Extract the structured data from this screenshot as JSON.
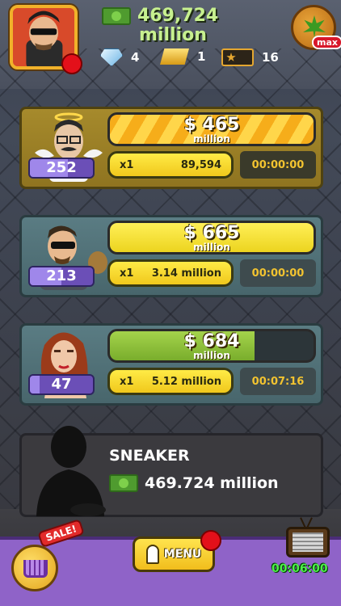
{
  "hud": {
    "money_value": "469,724",
    "money_unit": "million",
    "gems": "4",
    "gold": "1",
    "tickets": "16",
    "max_label": "max"
  },
  "cards": [
    {
      "price": "$ 465",
      "price_unit": "million",
      "multiplier": "x1",
      "amount": "89,594",
      "timer": "00:00:00",
      "level": "252",
      "progress": 1.0,
      "level_progress": 0.6
    },
    {
      "price": "$ 665",
      "price_unit": "million",
      "multiplier": "x1",
      "amount": "3.14 million",
      "timer": "00:00:00",
      "level": "213",
      "progress": 1.0,
      "level_progress": 0.5
    },
    {
      "price": "$ 684",
      "price_unit": "million",
      "multiplier": "x1",
      "amount": "5.12 million",
      "timer": "00:07:16",
      "level": "47",
      "progress": 0.71,
      "level_progress": 0.15
    }
  ],
  "locked": {
    "name": "SNEAKER",
    "cost": "469.724 million"
  },
  "bottom": {
    "sale_label": "SALE!",
    "menu_label": "MENU",
    "tv_timer": "00:06:00"
  }
}
